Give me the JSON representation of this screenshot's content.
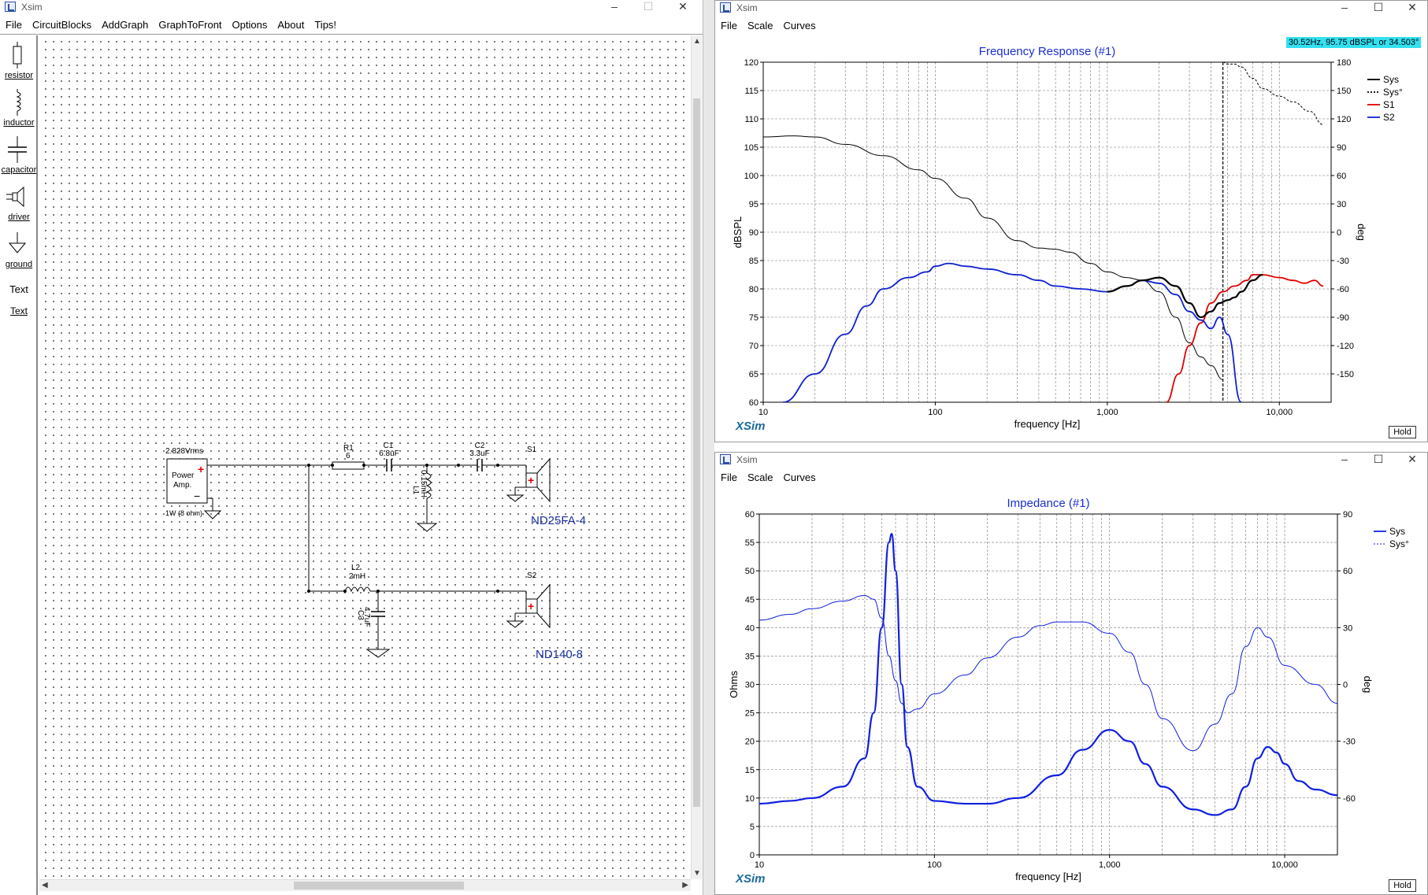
{
  "circuit_window": {
    "title": "Xsim",
    "menu": [
      "File",
      "CircuitBlocks",
      "AddGraph",
      "GraphToFront",
      "Options",
      "About",
      "Tips!"
    ],
    "tools": [
      "resistor",
      "inductor",
      "capacitor",
      "driver",
      "ground",
      "Text",
      "Text"
    ],
    "components": {
      "source_voltage": "2.828Vrms",
      "source_label_1": "Power",
      "source_label_2": "Amp.",
      "source_power": "1W (8 ohm)",
      "r1_name": "R1",
      "r1_value": "6",
      "c1_name": "C1",
      "c1_value": "6.8uF",
      "c2_name": "C2",
      "c2_value": "3.3uF",
      "l1_name": "L1",
      "l1_value": "0.15mH",
      "l2_name": "L2",
      "l2_value": "2mH",
      "c3_name": "C3",
      "c3_value": "4.7uF",
      "s1_name": "S1",
      "s2_name": "S2",
      "s1_model": "ND25FA-4",
      "s2_model": "ND140-8",
      "plus": "+",
      "minus": "−"
    }
  },
  "freq_window": {
    "title": "Xsim",
    "menu": [
      "File",
      "Scale",
      "Curves"
    ],
    "readout": "30.52Hz, 95.75 dBSPL or 34.503°",
    "xsim": "XSim",
    "hold": "Hold"
  },
  "imp_window": {
    "title": "Xsim",
    "menu": [
      "File",
      "Scale",
      "Curves"
    ],
    "xsim": "XSim",
    "hold": "Hold"
  },
  "colors": {
    "sys": "#000000",
    "s1": "#e00000",
    "s2": "#1020d0",
    "title": "#1a2fd0",
    "imp": "#1020e0"
  },
  "chart_data": [
    {
      "type": "line",
      "title": "Frequency Response (#1)",
      "xlabel": "frequency [Hz]",
      "ylabel": "dBSPL",
      "y2label": "deg",
      "xscale": "log",
      "xlim": [
        10,
        20000
      ],
      "ylim": [
        60,
        120
      ],
      "y2lim": [
        -180,
        180
      ],
      "xticks": [
        "10",
        "100",
        "1,000",
        "10,000"
      ],
      "yticks": [
        "120",
        "115",
        "110",
        "105",
        "100",
        "95",
        "90",
        "85",
        "80",
        "75",
        "70",
        "65",
        "60"
      ],
      "y2ticks": [
        "180",
        "150",
        "120",
        "90",
        "60",
        "30",
        "0",
        "-30",
        "-60",
        "-90",
        "-120",
        "-150"
      ],
      "grid": true,
      "legend": "top-right",
      "cursor_x": 4700,
      "series": [
        {
          "name": "Sys",
          "style": "solid-thin",
          "color": "#000000",
          "x": [
            10,
            15,
            20,
            30,
            50,
            80,
            100,
            150,
            200,
            300,
            400,
            500,
            600,
            800,
            1000,
            1300,
            1600,
            2000,
            2500,
            3000,
            3500,
            4000,
            4700
          ],
          "values": [
            106.8,
            107,
            106.8,
            105.5,
            103.5,
            101,
            99.5,
            96,
            92.5,
            88.5,
            87.2,
            87,
            86.5,
            84.5,
            83,
            82,
            81.5,
            79.5,
            75,
            70.5,
            68,
            66.5,
            64
          ]
        },
        {
          "name": "Sys°",
          "style": "dashed",
          "color": "#000000",
          "x": [
            4700,
            5000,
            5500,
            6000,
            7000,
            8000,
            10000,
            12000,
            15000,
            18000
          ],
          "values": [
            180,
            178,
            178,
            175,
            163,
            152,
            144,
            138,
            128,
            114
          ]
        },
        {
          "name": "S1",
          "style": "solid",
          "color": "#e00000",
          "x": [
            2200,
            2600,
            3000,
            3500,
            4000,
            4700,
            5500,
            6500,
            7000,
            8000,
            10000,
            12000,
            14000,
            16000,
            18000
          ],
          "values": [
            60,
            65,
            70,
            74,
            77.5,
            79.5,
            80.5,
            81.5,
            82.5,
            82.5,
            82,
            81.5,
            81,
            81.5,
            80.5
          ]
        },
        {
          "name": "S2",
          "style": "solid",
          "color": "#1020d0",
          "x": [
            13,
            20,
            30,
            40,
            50,
            70,
            90,
            100,
            120,
            150,
            200,
            300,
            400,
            500,
            700,
            1000,
            1300,
            1600,
            2000,
            2500,
            3000,
            3500,
            4000,
            4500,
            5000,
            6000
          ],
          "values": [
            60,
            65,
            72,
            77,
            80,
            82,
            83,
            84,
            84.5,
            84,
            83.5,
            82.5,
            81.5,
            80.5,
            80,
            79.5,
            80.5,
            81.5,
            81,
            79,
            76,
            74.5,
            73,
            75,
            72,
            60
          ]
        },
        {
          "name": "Sys",
          "style": "solid-thick",
          "color": "#000000",
          "x": [
            1000,
            1300,
            1600,
            2000,
            2500,
            3000,
            3500,
            4000,
            4500,
            5000,
            5500,
            6000,
            7000,
            8000
          ],
          "values": [
            79.5,
            80.5,
            81.5,
            82,
            80.5,
            77.5,
            75,
            76,
            77.5,
            78,
            78.5,
            79.5,
            81.5,
            82.5
          ]
        }
      ]
    },
    {
      "type": "line",
      "title": "Impedance (#1)",
      "xlabel": "frequency [Hz]",
      "ylabel": "Ohms",
      "y2label": "deg",
      "xscale": "log",
      "xlim": [
        10,
        20000
      ],
      "ylim": [
        0,
        60
      ],
      "y2lim": [
        -90,
        90
      ],
      "xticks": [
        "10",
        "100",
        "1,000",
        "10,000"
      ],
      "yticks": [
        "60",
        "55",
        "50",
        "45",
        "40",
        "35",
        "30",
        "25",
        "20",
        "15",
        "10",
        "5",
        "0"
      ],
      "y2ticks": [
        "90",
        "60",
        "30",
        "0",
        "-30",
        "-60"
      ],
      "grid": true,
      "legend": "top-right",
      "series": [
        {
          "name": "Sys",
          "style": "solid-thick",
          "color": "#1020e0",
          "x": [
            10,
            15,
            20,
            30,
            40,
            45,
            50,
            55,
            57,
            60,
            65,
            70,
            80,
            100,
            150,
            200,
            300,
            500,
            700,
            1000,
            1300,
            1600,
            2000,
            3000,
            4000,
            5000,
            6000,
            7000,
            8000,
            9000,
            10000,
            12000,
            15000,
            20000
          ],
          "values": [
            9,
            9.5,
            10,
            12,
            17,
            25,
            40,
            55,
            56.5,
            50,
            30,
            19,
            12,
            9.5,
            9,
            9,
            10,
            14,
            18.5,
            22,
            20,
            16,
            12,
            8,
            7,
            8,
            12,
            17,
            19,
            18,
            16,
            13,
            11.5,
            10.5
          ]
        },
        {
          "name": "Sys°",
          "style": "thin",
          "color": "#1020e0",
          "x": [
            10,
            15,
            20,
            30,
            40,
            45,
            50,
            55,
            60,
            65,
            70,
            80,
            100,
            150,
            200,
            300,
            400,
            500,
            700,
            1000,
            1300,
            1600,
            2000,
            3000,
            4000,
            5000,
            6000,
            7000,
            8000,
            10000,
            15000,
            20000
          ],
          "values": [
            34,
            37,
            40,
            44,
            47,
            45,
            35,
            15,
            2,
            -10,
            -15,
            -13,
            -5,
            5,
            14,
            25,
            31,
            33,
            33,
            27,
            17,
            0,
            -18,
            -35,
            -21,
            -5,
            20,
            30,
            25,
            10,
            0,
            -10
          ]
        }
      ]
    }
  ]
}
